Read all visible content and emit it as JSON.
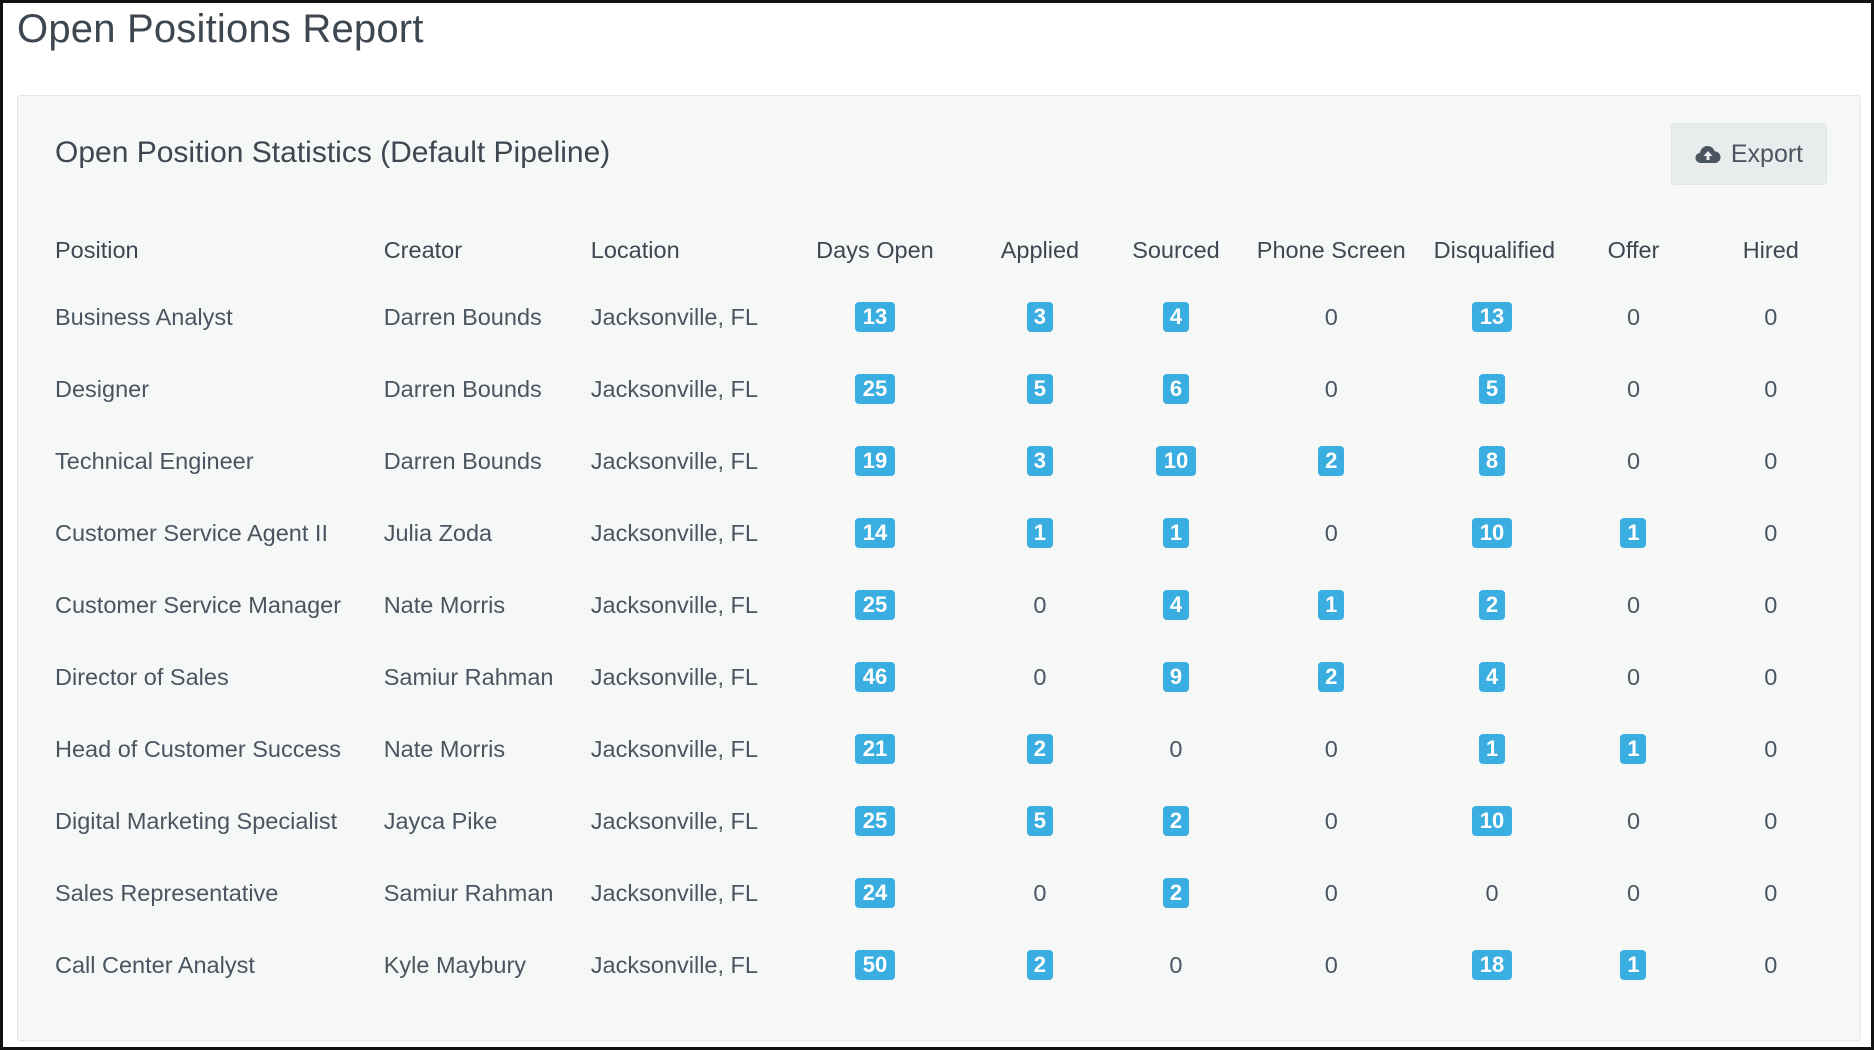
{
  "page": {
    "title": "Open Positions Report"
  },
  "panel": {
    "title": "Open Position Statistics (Default Pipeline)",
    "export": {
      "label": "Export",
      "icon": "cloud-upload-icon"
    }
  },
  "table": {
    "columns": [
      "Position",
      "Creator",
      "Location",
      "Days Open",
      "Applied",
      "Sourced",
      "Phone Screen",
      "Disqualified",
      "Offer",
      "Hired"
    ],
    "rows": [
      {
        "position": "Business Analyst",
        "creator": "Darren Bounds",
        "location": "Jacksonville, FL",
        "days_open": 13,
        "applied": 3,
        "sourced": 4,
        "phone_screen": 0,
        "disqualified": 13,
        "offer": 0,
        "hired": 0
      },
      {
        "position": "Designer",
        "creator": "Darren Bounds",
        "location": "Jacksonville, FL",
        "days_open": 25,
        "applied": 5,
        "sourced": 6,
        "phone_screen": 0,
        "disqualified": 5,
        "offer": 0,
        "hired": 0
      },
      {
        "position": "Technical Engineer",
        "creator": "Darren Bounds",
        "location": "Jacksonville, FL",
        "days_open": 19,
        "applied": 3,
        "sourced": 10,
        "phone_screen": 2,
        "disqualified": 8,
        "offer": 0,
        "hired": 0
      },
      {
        "position": "Customer Service Agent II",
        "creator": "Julia Zoda",
        "location": "Jacksonville, FL",
        "days_open": 14,
        "applied": 1,
        "sourced": 1,
        "phone_screen": 0,
        "disqualified": 10,
        "offer": 1,
        "hired": 0
      },
      {
        "position": "Customer Service Manager",
        "creator": "Nate Morris",
        "location": "Jacksonville, FL",
        "days_open": 25,
        "applied": 0,
        "sourced": 4,
        "phone_screen": 1,
        "disqualified": 2,
        "offer": 0,
        "hired": 0
      },
      {
        "position": "Director of Sales",
        "creator": "Samiur Rahman",
        "location": "Jacksonville, FL",
        "days_open": 46,
        "applied": 0,
        "sourced": 9,
        "phone_screen": 2,
        "disqualified": 4,
        "offer": 0,
        "hired": 0
      },
      {
        "position": "Head of Customer Success",
        "creator": "Nate Morris",
        "location": "Jacksonville, FL",
        "days_open": 21,
        "applied": 2,
        "sourced": 0,
        "phone_screen": 0,
        "disqualified": 1,
        "offer": 1,
        "hired": 0
      },
      {
        "position": "Digital Marketing Specialist",
        "creator": "Jayca Pike",
        "location": "Jacksonville, FL",
        "days_open": 25,
        "applied": 5,
        "sourced": 2,
        "phone_screen": 0,
        "disqualified": 10,
        "offer": 0,
        "hired": 0
      },
      {
        "position": "Sales Representative",
        "creator": "Samiur Rahman",
        "location": "Jacksonville, FL",
        "days_open": 24,
        "applied": 0,
        "sourced": 2,
        "phone_screen": 0,
        "disqualified": 0,
        "offer": 0,
        "hired": 0
      },
      {
        "position": "Call Center Analyst",
        "creator": "Kyle Maybury",
        "location": "Jacksonville, FL",
        "days_open": 50,
        "applied": 2,
        "sourced": 0,
        "phone_screen": 0,
        "disqualified": 18,
        "offer": 1,
        "hired": 0
      }
    ]
  },
  "colors": {
    "badge": "#3aaee0",
    "text": "#4a5560",
    "panel_bg": "#f6f8f8"
  }
}
